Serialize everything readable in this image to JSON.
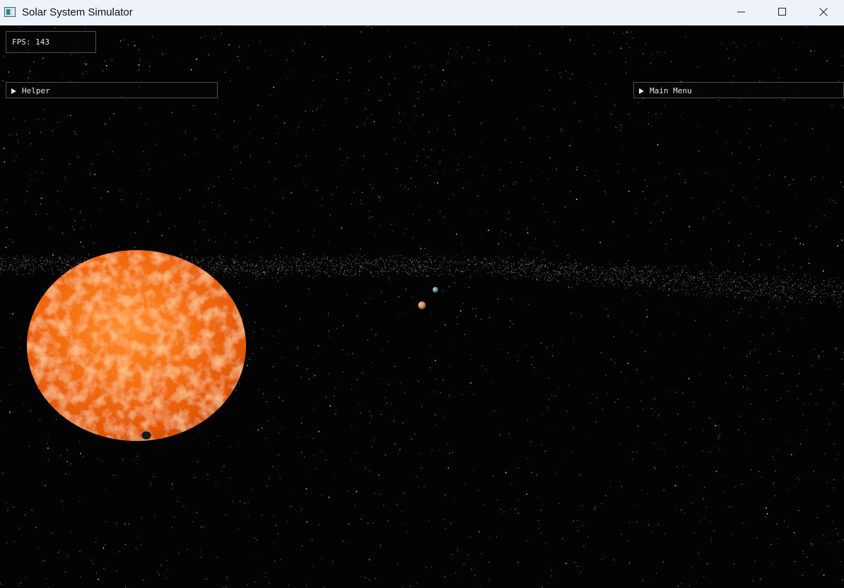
{
  "window": {
    "title": "Solar System Simulator",
    "icons": {
      "app": "app-window-icon",
      "minimize": "minimize-icon",
      "maximize": "maximize-icon",
      "close": "close-icon"
    }
  },
  "overlay": {
    "fps_label": "FPS: 143"
  },
  "panels": {
    "helper": {
      "label": "Helper",
      "expanded": false,
      "icon": "collapsed-arrow-icon"
    },
    "main_menu": {
      "label": "Main Menu",
      "expanded": false,
      "icon": "collapsed-arrow-icon"
    }
  },
  "scene": {
    "background": "#030303",
    "sun_color": "#f26a0c",
    "asteroid_belt_color": "#b9ab84",
    "planet_colors": {
      "orange_planet": "#c7865a",
      "blue_planet": "#6d8fa0",
      "dark_planet": "#202020"
    }
  }
}
